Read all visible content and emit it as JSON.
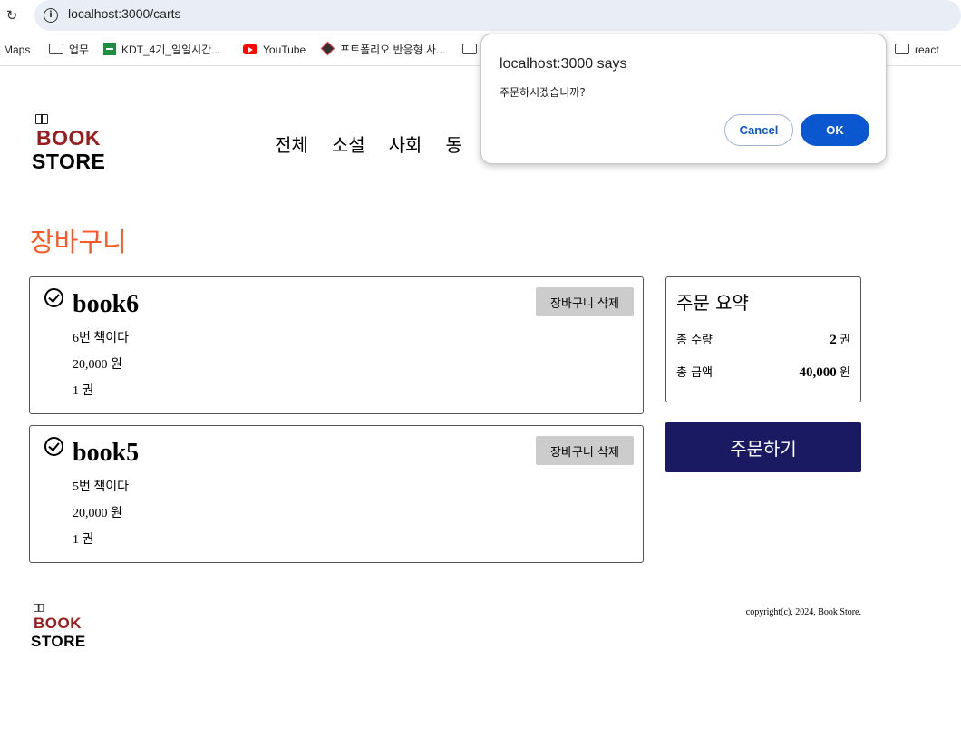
{
  "browser": {
    "url": "localhost:3000/carts",
    "bookmarks": [
      {
        "label": "Maps",
        "icon": "none"
      },
      {
        "label": "업무",
        "icon": "folder-icon"
      },
      {
        "label": "KDT_4기_일일시간...",
        "icon": "sheets-icon"
      },
      {
        "label": "YouTube",
        "icon": "youtube-icon"
      },
      {
        "label": "포트폴리오 반응형 사...",
        "icon": "diamond-icon"
      },
      {
        "label": "",
        "icon": "folder-icon"
      },
      {
        "label": "react",
        "icon": "folder-icon"
      }
    ]
  },
  "header": {
    "logo_line1": "BOOK",
    "logo_line2": "STORE",
    "nav": [
      "전체",
      "소설",
      "사회",
      "동"
    ]
  },
  "page": {
    "title": "장바구니"
  },
  "cart": {
    "delete_label": "장바구니 삭제",
    "items": [
      {
        "title": "book6",
        "summary": "6번 책이다",
        "price": "20,000 원",
        "quantity": "1 권"
      },
      {
        "title": "book5",
        "summary": "5번 책이다",
        "price": "20,000 원",
        "quantity": "1 권"
      }
    ]
  },
  "summary": {
    "title": "주문 요약",
    "qty_label": "총 수량",
    "qty_value": "2",
    "qty_unit": " 권",
    "amount_label": "총 금액",
    "amount_value": "40,000",
    "amount_unit": " 원",
    "order_label": "주문하기"
  },
  "footer": {
    "logo_line1": "BOOK",
    "logo_line2": "STORE",
    "copyright": "copyright(c), 2024, Book Store."
  },
  "dialog": {
    "title": "localhost:3000 says",
    "message": "주문하시겠습니까?",
    "cancel_label": "Cancel",
    "ok_label": "OK"
  },
  "colors": {
    "accent_title": "#ff5722",
    "logo_red": "#9b1c1c",
    "order_button": "#1a1a63",
    "dialog_primary": "#0b57d0"
  }
}
